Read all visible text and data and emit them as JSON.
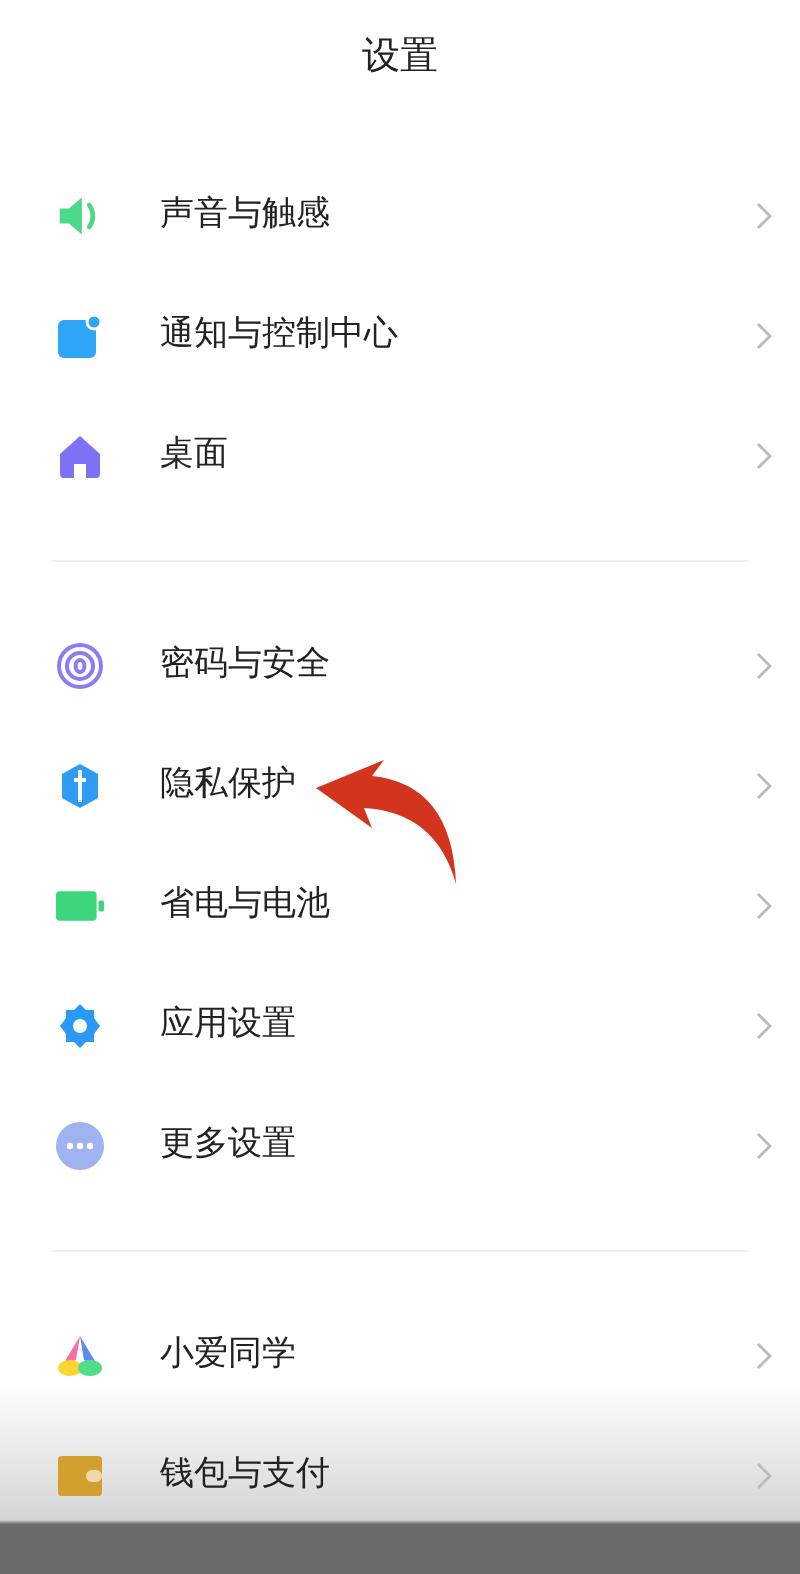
{
  "title": "设置",
  "groups": [
    {
      "items": [
        {
          "label": "声音与触感",
          "kind": "sound"
        },
        {
          "label": "通知与控制中心",
          "kind": "notify"
        },
        {
          "label": "桌面",
          "kind": "home"
        }
      ]
    },
    {
      "items": [
        {
          "label": "密码与安全",
          "kind": "fingerprint"
        },
        {
          "label": "隐私保护",
          "kind": "privacy"
        },
        {
          "label": "省电与电池",
          "kind": "battery"
        },
        {
          "label": "应用设置",
          "kind": "gear"
        },
        {
          "label": "更多设置",
          "kind": "more"
        }
      ]
    },
    {
      "items": [
        {
          "label": "小爱同学",
          "kind": "assistant"
        },
        {
          "label": "钱包与支付",
          "kind": "wallet"
        }
      ]
    }
  ]
}
